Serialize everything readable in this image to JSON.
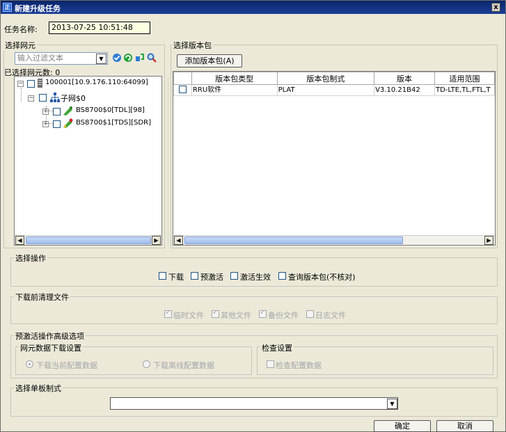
{
  "window": {
    "title": "新建升级任务",
    "close_glyph": "x"
  },
  "task": {
    "name_label": "任务名称:",
    "name_value": "2013-07-25 10:51:48"
  },
  "ne_select": {
    "group_title": "选择网元",
    "filter_placeholder": "输入过滤文本",
    "selected_count": "已选择网元数: 0",
    "tree": [
      {
        "label": "100001[10.9.176.110:64099]"
      },
      {
        "label": "子网$0"
      },
      {
        "label": "BS8700$0[TDL][98]"
      },
      {
        "label": "BS8700$1[TDS][SDR]"
      }
    ]
  },
  "package_select": {
    "group_title": "选择版本包",
    "add_button": "添加版本包(A)",
    "columns": [
      "",
      "版本包类型",
      "版本包制式",
      "版本",
      "适用范围"
    ],
    "rows": [
      {
        "type": "RRU软件",
        "mode": "PLAT",
        "version": "V3.10.21B42",
        "scope": "TD-LTE,TL,FTL,T"
      }
    ]
  },
  "operations": {
    "group_title": "选择操作",
    "options": [
      "下载",
      "预激活",
      "激活生效",
      "查询版本包(不核对)"
    ]
  },
  "cleanup": {
    "group_title": "下载前清理文件",
    "options": [
      {
        "label": "临时文件",
        "checked": true
      },
      {
        "label": "其他文件",
        "checked": true
      },
      {
        "label": "备份文件",
        "checked": true
      },
      {
        "label": "日志文件",
        "checked": false
      }
    ]
  },
  "preactivate": {
    "group_title": "预激活操作高级选项",
    "ne_data": {
      "title": "网元数据下载设置",
      "option_current": "下载当前配置数据",
      "option_offline": "下载离线配置数据"
    },
    "check": {
      "title": "检查设置",
      "option": "检查配置数据"
    }
  },
  "board_mode": {
    "group_title": "选择单板制式",
    "value": ""
  },
  "footer": {
    "ok": "确定",
    "cancel": "取消"
  }
}
